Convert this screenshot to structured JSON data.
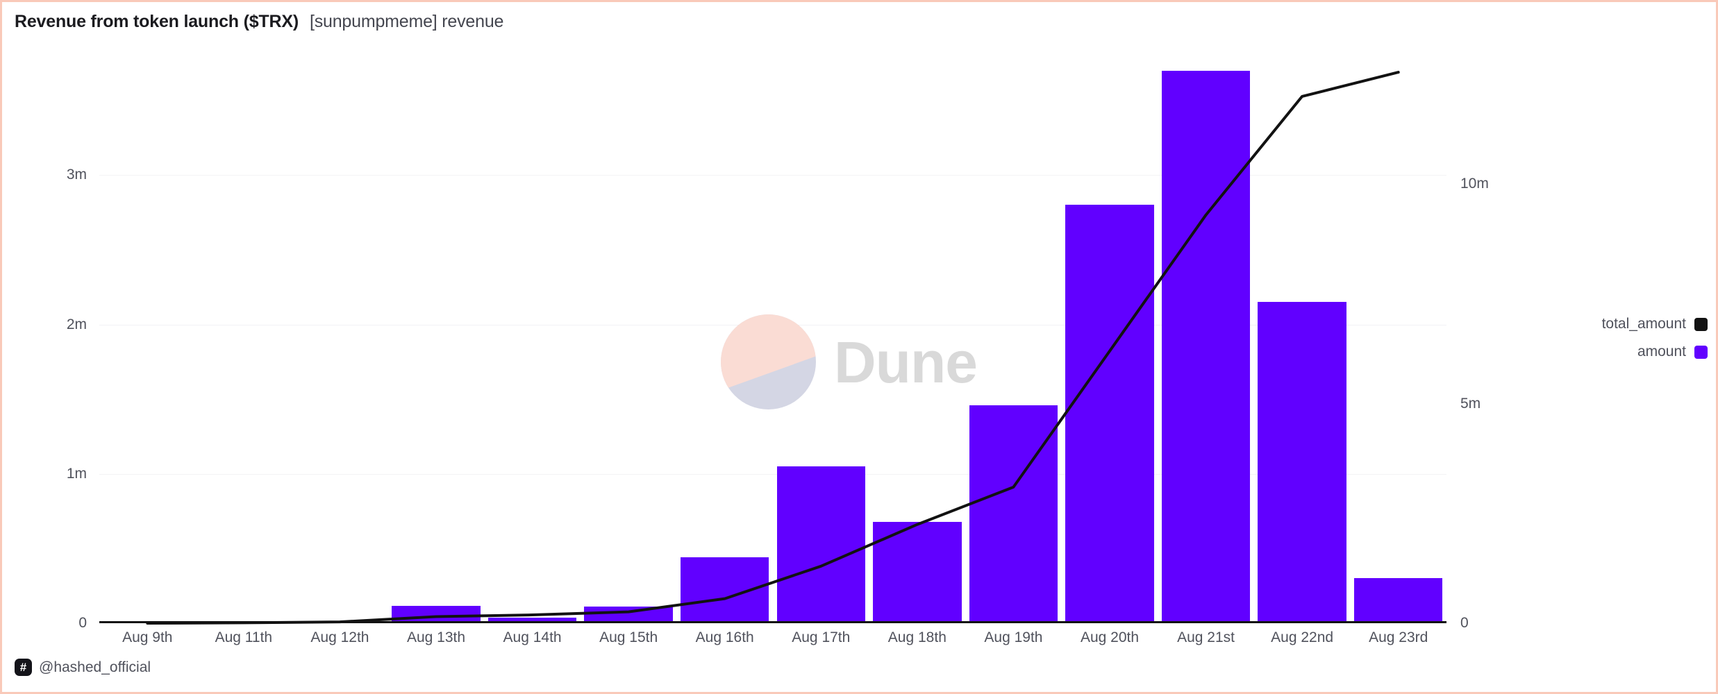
{
  "header": {
    "title": "Revenue from token launch ($TRX)",
    "subtitle": "[sunpumpmeme] revenue"
  },
  "footer": {
    "badge_icon": "hash-icon",
    "badge_glyph": "#",
    "handle": "@hashed_official"
  },
  "watermark": {
    "text": "Dune",
    "icon": "dune-logo-icon",
    "pink": "#fadcd4",
    "lavender": "#d4d6e4",
    "text_color": "#d9d9d9"
  },
  "legend": {
    "position": "right",
    "items": [
      {
        "label": "total_amount",
        "color": "#121212"
      },
      {
        "label": "amount",
        "color": "#6100ff"
      }
    ]
  },
  "chart_data": {
    "type": "bar",
    "title": "Revenue from token launch ($TRX)",
    "subtitle": "[sunpumpmeme] revenue",
    "xlabel": "",
    "ylabel": "",
    "grid": true,
    "categories": [
      "Aug 9th",
      "Aug 11th",
      "Aug 12th",
      "Aug 13th",
      "Aug 14th",
      "Aug 15th",
      "Aug 16th",
      "Aug 17th",
      "Aug 18th",
      "Aug 19th",
      "Aug 20th",
      "Aug 21st",
      "Aug 22nd",
      "Aug 23rd"
    ],
    "left_axis": {
      "label": "amount",
      "ticks": [
        0,
        1000000,
        2000000,
        3000000
      ],
      "ticklabels": [
        "0",
        "1m",
        "2m",
        "3m"
      ],
      "ylim": [
        0,
        3880000
      ]
    },
    "right_axis": {
      "label": "total_amount",
      "ticks": [
        0,
        5000000,
        10000000
      ],
      "ticklabels": [
        "0",
        "5m",
        "10m"
      ],
      "ylim": [
        0,
        13200000
      ]
    },
    "series": [
      {
        "name": "amount",
        "type": "bar",
        "color": "#6100ff",
        "axis": "left",
        "values": [
          0,
          0,
          0,
          115000,
          35000,
          110000,
          440000,
          1050000,
          680000,
          1460000,
          2800000,
          3700000,
          2150000,
          300000
        ]
      },
      {
        "name": "total_amount",
        "type": "line",
        "color": "#121212",
        "axis": "right",
        "values": [
          0,
          10000,
          30000,
          150000,
          190000,
          260000,
          560000,
          1300000,
          2250000,
          3100000,
          6200000,
          9300000,
          12000000,
          12550000
        ]
      }
    ]
  }
}
